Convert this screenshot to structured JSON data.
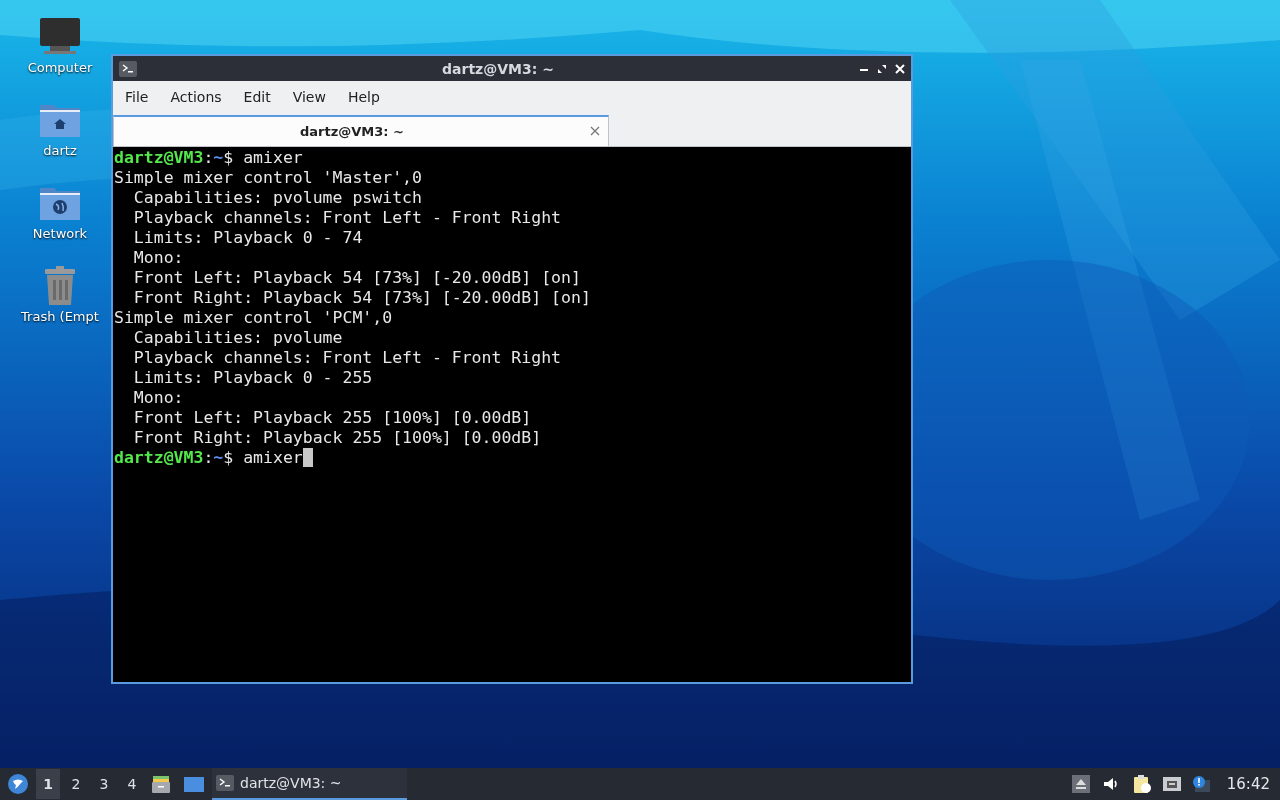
{
  "desktop": {
    "icons": [
      {
        "kind": "computer",
        "label": "Computer"
      },
      {
        "kind": "home",
        "label": "dartz"
      },
      {
        "kind": "network",
        "label": "Network"
      },
      {
        "kind": "trash",
        "label": "Trash (Empt"
      }
    ]
  },
  "window": {
    "title": "dartz@VM3: ~",
    "menu": [
      "File",
      "Actions",
      "Edit",
      "View",
      "Help"
    ],
    "tabs": [
      {
        "label": "dartz@VM3: ~",
        "selected": true
      }
    ],
    "terminal": {
      "lines": [
        {
          "kind": "prompt",
          "user": "dartz@VM3",
          "sep": ":",
          "path": "~",
          "text": "$ amixer",
          "cursor": false
        },
        {
          "kind": "output",
          "text": "Simple mixer control 'Master',0"
        },
        {
          "kind": "output",
          "text": "  Capabilities: pvolume pswitch"
        },
        {
          "kind": "output",
          "text": "  Playback channels: Front Left - Front Right"
        },
        {
          "kind": "output",
          "text": "  Limits: Playback 0 - 74"
        },
        {
          "kind": "output",
          "text": "  Mono:"
        },
        {
          "kind": "output",
          "text": "  Front Left: Playback 54 [73%] [-20.00dB] [on]"
        },
        {
          "kind": "output",
          "text": "  Front Right: Playback 54 [73%] [-20.00dB] [on]"
        },
        {
          "kind": "output",
          "text": "Simple mixer control 'PCM',0"
        },
        {
          "kind": "output",
          "text": "  Capabilities: pvolume"
        },
        {
          "kind": "output",
          "text": "  Playback channels: Front Left - Front Right"
        },
        {
          "kind": "output",
          "text": "  Limits: Playback 0 - 255"
        },
        {
          "kind": "output",
          "text": "  Mono:"
        },
        {
          "kind": "output",
          "text": "  Front Left: Playback 255 [100%] [0.00dB]"
        },
        {
          "kind": "output",
          "text": "  Front Right: Playback 255 [100%] [0.00dB]"
        },
        {
          "kind": "prompt",
          "user": "dartz@VM3",
          "sep": ":",
          "path": "~",
          "text": "$ amixer",
          "cursor": true
        }
      ]
    }
  },
  "taskbar": {
    "workspaces": [
      {
        "label": "1",
        "selected": true
      },
      {
        "label": "2",
        "selected": false
      },
      {
        "label": "3",
        "selected": false
      },
      {
        "label": "4",
        "selected": false
      }
    ],
    "launchers": [
      {
        "kind": "file-manager"
      },
      {
        "kind": "show-desktop"
      }
    ],
    "tasks": [
      {
        "label": "dartz@VM3: ~",
        "selected": true
      }
    ],
    "tray": [
      {
        "kind": "eject"
      },
      {
        "kind": "volume"
      },
      {
        "kind": "clipboard"
      },
      {
        "kind": "network"
      },
      {
        "kind": "notification"
      }
    ],
    "clock": "16:42"
  }
}
